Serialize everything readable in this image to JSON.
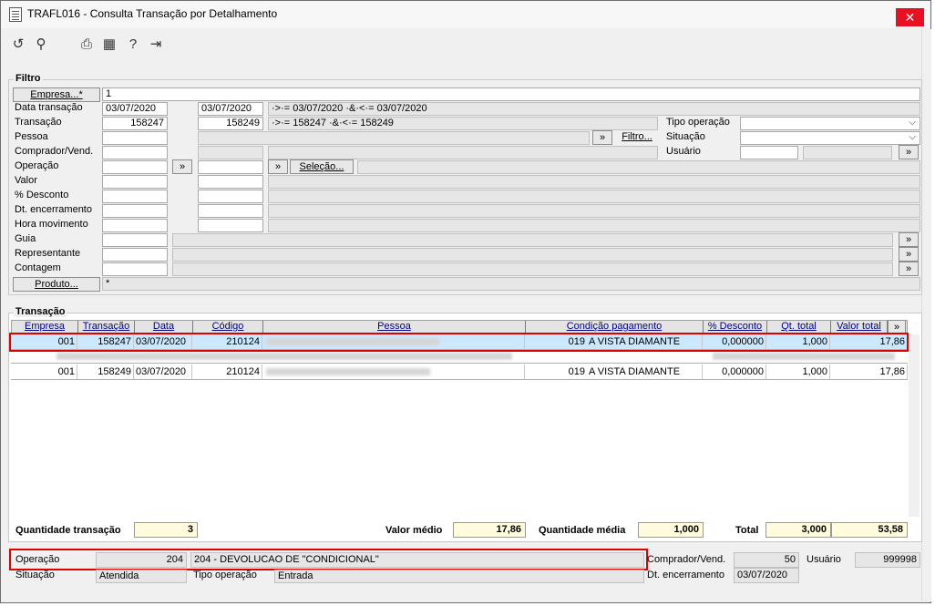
{
  "window": {
    "title": "TRAFL016 - Consulta Transação por Detalhamento",
    "close": "✕"
  },
  "toolbar": {
    "icons": [
      "undo-icon",
      "search-icon",
      "print-icon",
      "calendar-icon",
      "help-icon",
      "exit-icon"
    ]
  },
  "filtro": {
    "title": "Filtro",
    "empresa_button": "Empresa...*",
    "empresa_value": "1",
    "labels": [
      "Data transação",
      "Transação",
      "Pessoa",
      "Comprador/Vend.",
      "Operação",
      "Valor",
      "% Desconto",
      "Dt. encerramento",
      "Hora movimento",
      "Guia",
      "Representante",
      "Contagem"
    ],
    "data_from": "03/07/2020",
    "data_to": "03/07/2020",
    "data_expr": "·>·= 03/07/2020 ·&·<·= 03/07/2020",
    "trans_from": "158247",
    "trans_to": "158249",
    "trans_expr": "·>·= 158247 ·&·<·= 158249",
    "arrow": "»",
    "filtro_button": "Filtro...",
    "selecao_button": "Seleção...",
    "produto_button": "Produto...",
    "produto_value": "*",
    "tipo_operacao_label": "Tipo operação",
    "situacao_label": "Situação",
    "usuario_label": "Usuário"
  },
  "transacao": {
    "title": "Transação",
    "columns": [
      "Empresa",
      "Transação",
      "Data",
      "Código",
      "Pessoa",
      "Condição pagamento",
      "% Desconto",
      "Qt. total",
      "Valor total"
    ],
    "more": "»",
    "rows": [
      {
        "empresa": "001",
        "transacao": "158247",
        "data": "03/07/2020",
        "codigo": "210124",
        "cond_cod": "019",
        "cond": "A VISTA DIAMANTE",
        "desconto": "0,000000",
        "qt": "1,000",
        "valor": "17,86"
      },
      {
        "empresa": "001",
        "transacao": "158249",
        "data": "03/07/2020",
        "codigo": "210124",
        "cond_cod": "019",
        "cond": "A VISTA DIAMANTE",
        "desconto": "0,000000",
        "qt": "1,000",
        "valor": "17,86"
      }
    ]
  },
  "totals": {
    "qtd_transacao_label": "Quantidade transação",
    "qtd_transacao": "3",
    "valor_medio_label": "Valor médio",
    "valor_medio": "17,86",
    "qtd_media_label": "Quantidade média",
    "qtd_media": "1,000",
    "total_label": "Total",
    "total_qt": "3,000",
    "total_valor": "53,58"
  },
  "detail": {
    "operacao_label": "Operação",
    "operacao_code": "204",
    "operacao_desc": "204 - DEVOLUCAO DE \"CONDICIONAL\"",
    "comprador_label": "Comprador/Vend.",
    "comprador": "50",
    "usuario_label": "Usuário",
    "usuario": "999998",
    "situacao_label": "Situação",
    "situacao": "Atendida",
    "tipo_operacao_label": "Tipo operação",
    "tipo_operacao": "Entrada",
    "dt_enc_label": "Dt. encerramento",
    "dt_enc": "03/07/2020"
  },
  "colors": {
    "highlight_box": "#e00000",
    "selected_row": "#cce8ff",
    "totals_bg": "#fffbdc",
    "header_link": "#00008b"
  }
}
